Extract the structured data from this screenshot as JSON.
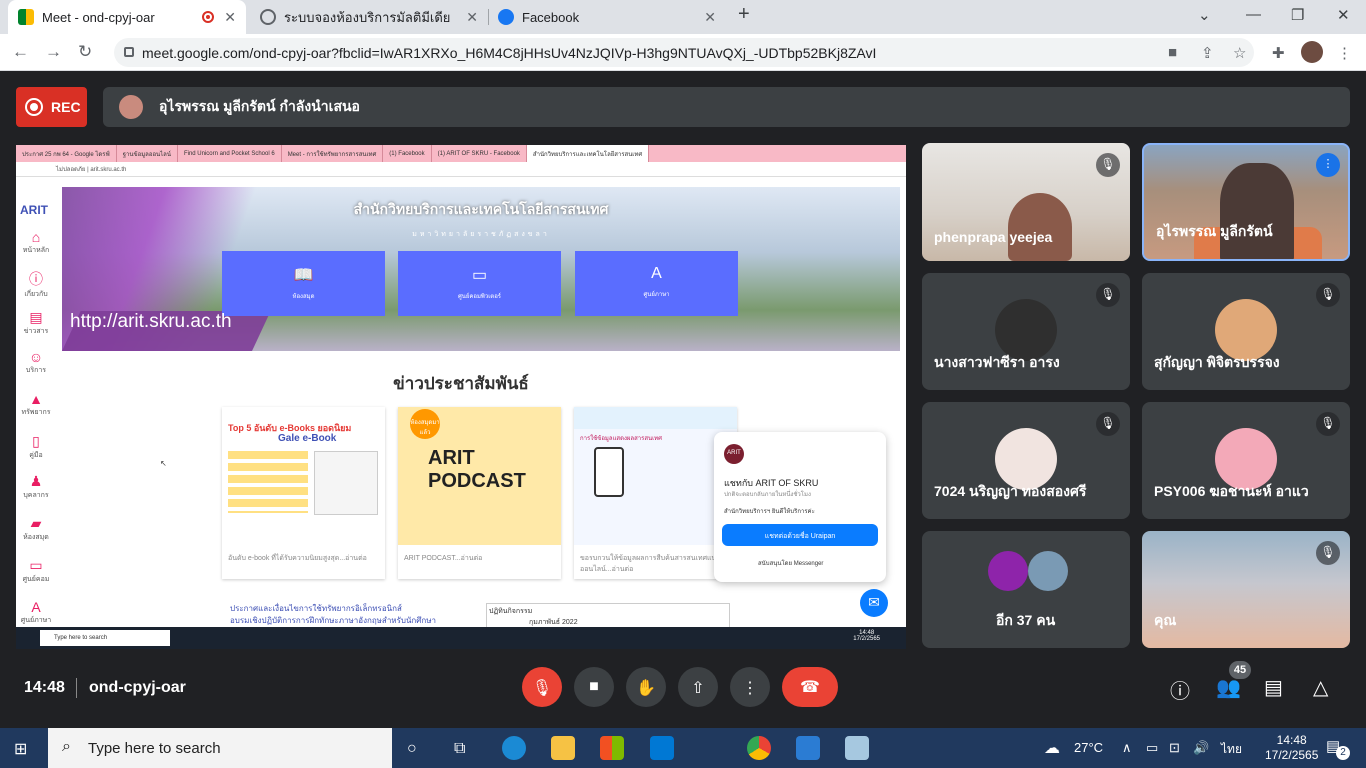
{
  "browser": {
    "tabs": [
      {
        "title": "Meet - ond-cpyj-oar"
      },
      {
        "title": "ระบบจองห้องบริการมัลติมีเดีย"
      },
      {
        "title": "Facebook"
      }
    ],
    "url": "meet.google.com/ond-cpyj-oar?fbclid=IwAR1XRXo_H6M4C8jHHsUv4NzJQIVp-H3hg9NTUAvQXj_-UDTbp52BKj8ZAvI"
  },
  "meet": {
    "rec_label": "REC",
    "presenter_text": "อุไรพรรณ มูลีกรัตน์ กำลังนำเสนอ",
    "time": "14:48",
    "meeting_code": "ond-cpyj-oar",
    "participants_count": "45",
    "tiles": [
      {
        "name": "phenprapa yeejea"
      },
      {
        "name": "อุไรพรรณ มูลีกรัตน์"
      },
      {
        "name": "นางสาวฟาซีรา อารง"
      },
      {
        "name": "สุกัญญา พิจิตรบรรจง"
      },
      {
        "name": "7024 นริญญา ทองสองศรี"
      },
      {
        "name": "PSY006 ฆอชานะห์ อาแว"
      },
      {
        "name": "อีก 37 คน"
      },
      {
        "name": "คุณ"
      }
    ]
  },
  "shared": {
    "inner_tabs": [
      "ประกาศ 25 กพ 64 - Google ไดรฟ์",
      "ฐานข้อมูลออนไลน์",
      "Find Unicorn and Pocket School 6",
      "Meet - การใช้ทรัพยากรสารสนเทศ",
      "(1) Facebook",
      "(1) ARIT OF SKRU - Facebook",
      "สำนักวิทยบริการและเทคโนโลยีสารสนเทศ"
    ],
    "inner_url": "ไม่ปลอดภัย | arit.skru.ac.th",
    "logo": "ARIT",
    "side_items": [
      "หน้าหลัก",
      "เกี่ยวกับ",
      "ข่าวสาร",
      "บริการ",
      "ทรัพยากร",
      "คู่มือ",
      "บุคลากร",
      "ห้องสมุด",
      "ศูนย์คอม",
      "ศูนย์ภาษา"
    ],
    "banner_title": "สำนักวิทยบริการและเทคโนโลยีสารสนเทศ",
    "banner_sub": "มหาวิทยาลัยราชภัฏสงขลา",
    "banner_url": "http://arit.skru.ac.th",
    "banner_buttons": [
      "ห้องสมุด",
      "ศูนย์คอมพิวเตอร์",
      "ศูนย์ภาษา"
    ],
    "news_title": "ข่าวประชาสัมพันธ์",
    "cards": [
      {
        "title_line1": "Top 5 อันดับ e-Books ยอดนิยม",
        "title_line2": "Gale e-Book",
        "caption": "อันดับ e-book ที่ได้รับความนิยมสูงสุด...อ่านต่อ"
      },
      {
        "badge": "ห้องสมุดมาแล้ว",
        "title": "ARIT PODCAST",
        "caption": "ARIT PODCAST...อ่านต่อ"
      },
      {
        "title": "การใช้ข้อมูลแสดงผลสารสนเทศ",
        "caption": "ขอรบกวนให้ข้อมูลผลการสืบค้นสารสนเทศแบบออนไลน์...อ่านต่อ"
      }
    ],
    "fb_chat": {
      "logo": "ARIT",
      "name": "แชทกับ ARIT OF SKRU",
      "sub": "ปกติจะตอบกลับภายในหนึ่งชั่วโมง",
      "sub2": "สำนักวิทยบริการฯ ยินดีให้บริการค่ะ",
      "button": "แชทต่อด้วยชื่อ Uraipan",
      "footer": "สนับสนุนโดย Messenger"
    },
    "links": [
      "ประกาศและเงื่อนไขการใช้ทรัพยากรอิเล็กทรอนิกส์",
      "อบรมเชิงปฏิบัติการการฝึกทักษะภาษาอังกฤษสำหรับนักศึกษา"
    ],
    "calendar_title": "ปฏิทินกิจกรรม",
    "calendar_month": "กุมภาพันธ์ 2022",
    "inner_search": "Type here to search",
    "inner_time": "14:48",
    "inner_date": "17/2/2565"
  },
  "taskbar": {
    "search_placeholder": "Type here to search",
    "temperature": "27°C",
    "lang": "ไทย",
    "time": "14:48",
    "date": "17/2/2565",
    "notifications": "2"
  },
  "colors": {
    "meet_bg": "#202124",
    "rec_red": "#d93025",
    "active_blue": "#8ab4f8",
    "taskbar": "#20395e"
  }
}
